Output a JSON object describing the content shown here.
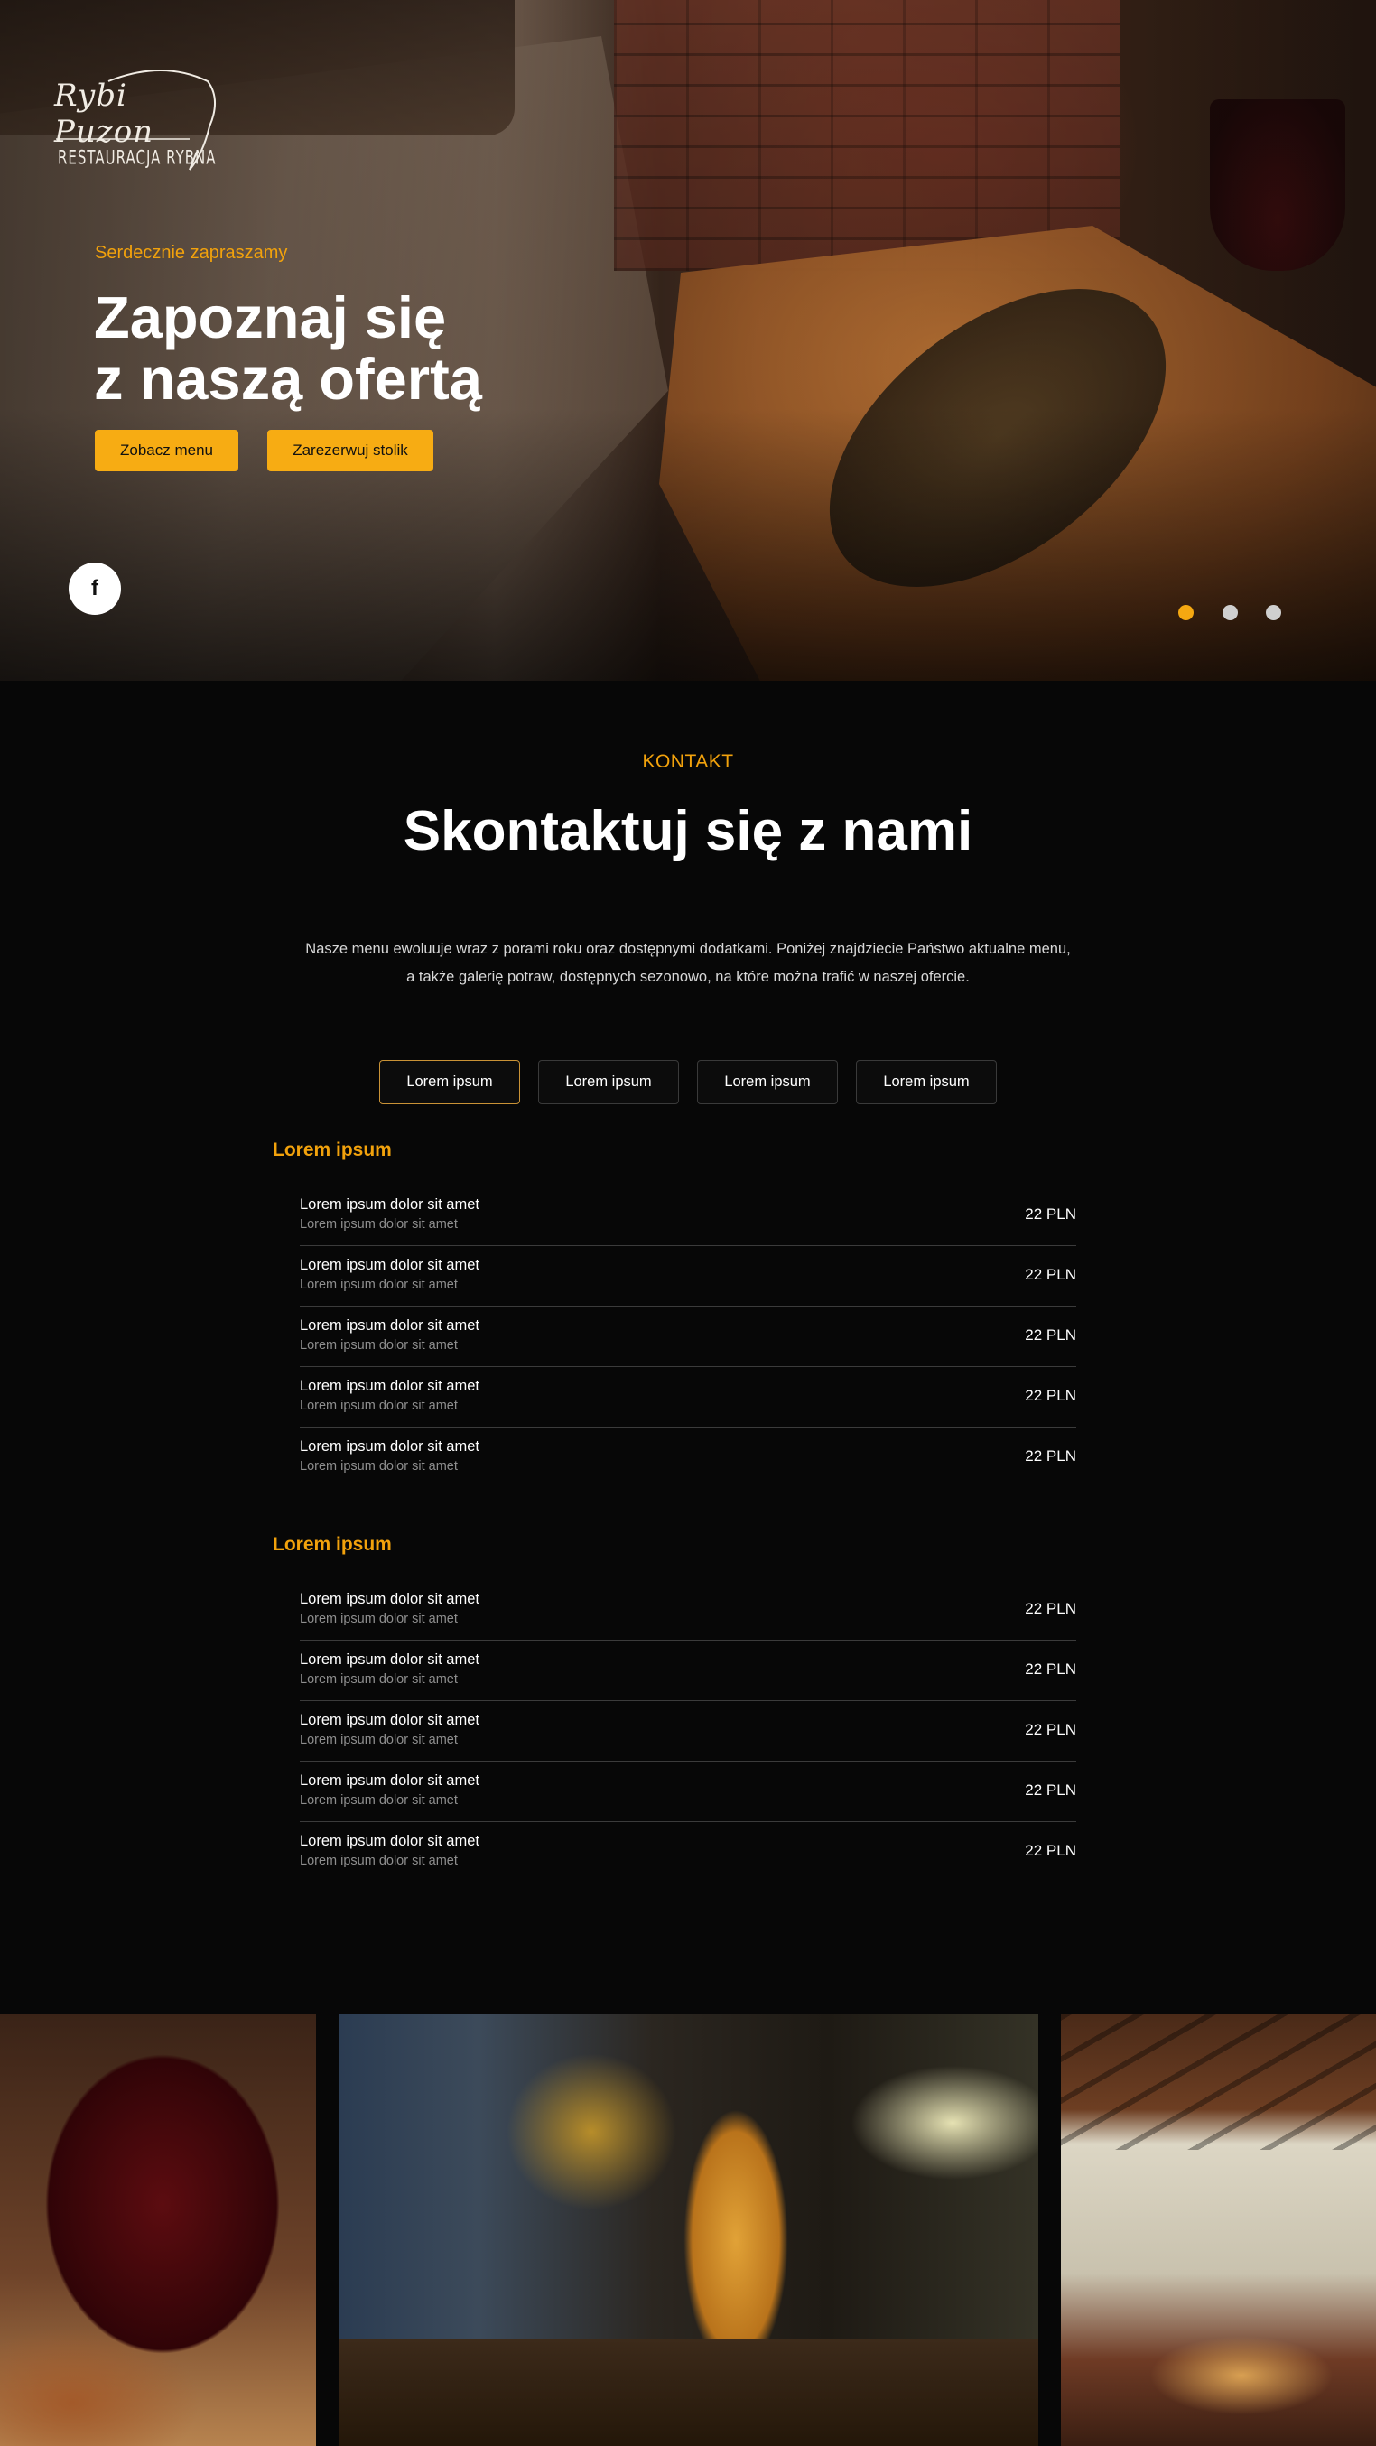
{
  "hero": {
    "logo_line1": "Rybi Puzon",
    "logo_line2": "RESTAURACJA RYBNA",
    "eyebrow": "Serdecznie zapraszamy",
    "title_line1": "Zapoznaj się",
    "title_line2": "z naszą ofertą",
    "btn_menu": "Zobacz menu",
    "btn_book": "Zarezerwuj stolik",
    "social_icon": "facebook-icon",
    "slides": 3,
    "active_slide": 1
  },
  "contact": {
    "eyebrow": "KONTAKT",
    "title": "Skontaktuj się z nami",
    "desc_line1": "Nasze menu ewoluuje wraz z porami roku oraz dostępnymi dodatkami. Poniżej znajdziecie Państwo aktualne menu,",
    "desc_line2": "a także galerię potraw, dostępnych sezonowo, na które można trafić w naszej ofercie."
  },
  "tabs": [
    "Lorem ipsum",
    "Lorem ipsum",
    "Lorem ipsum",
    "Lorem ipsum"
  ],
  "categories": [
    {
      "title": "Lorem ipsum",
      "items": [
        {
          "name": "Lorem ipsum dolor sit amet",
          "sub": "Lorem ipsum dolor sit amet",
          "price": "22 PLN"
        },
        {
          "name": "Lorem ipsum dolor sit amet",
          "sub": "Lorem ipsum dolor sit amet",
          "price": "22 PLN"
        },
        {
          "name": "Lorem ipsum dolor sit amet",
          "sub": "Lorem ipsum dolor sit amet",
          "price": "22 PLN"
        },
        {
          "name": "Lorem ipsum dolor sit amet",
          "sub": "Lorem ipsum dolor sit amet",
          "price": "22 PLN"
        },
        {
          "name": "Lorem ipsum dolor sit amet",
          "sub": "Lorem ipsum dolor sit amet",
          "price": "22 PLN"
        }
      ]
    },
    {
      "title": "Lorem ipsum",
      "items": [
        {
          "name": "Lorem ipsum dolor sit amet",
          "sub": "Lorem ipsum dolor sit amet",
          "price": "22 PLN"
        },
        {
          "name": "Lorem ipsum dolor sit amet",
          "sub": "Lorem ipsum dolor sit amet",
          "price": "22 PLN"
        },
        {
          "name": "Lorem ipsum dolor sit amet",
          "sub": "Lorem ipsum dolor sit amet",
          "price": "22 PLN"
        },
        {
          "name": "Lorem ipsum dolor sit amet",
          "sub": "Lorem ipsum dolor sit amet",
          "price": "22 PLN"
        },
        {
          "name": "Lorem ipsum dolor sit amet",
          "sub": "Lorem ipsum dolor sit amet",
          "price": "22 PLN"
        }
      ]
    }
  ],
  "colors": {
    "accent": "#f7ac13",
    "background": "#070707",
    "tab_active_border": "#c99236"
  }
}
